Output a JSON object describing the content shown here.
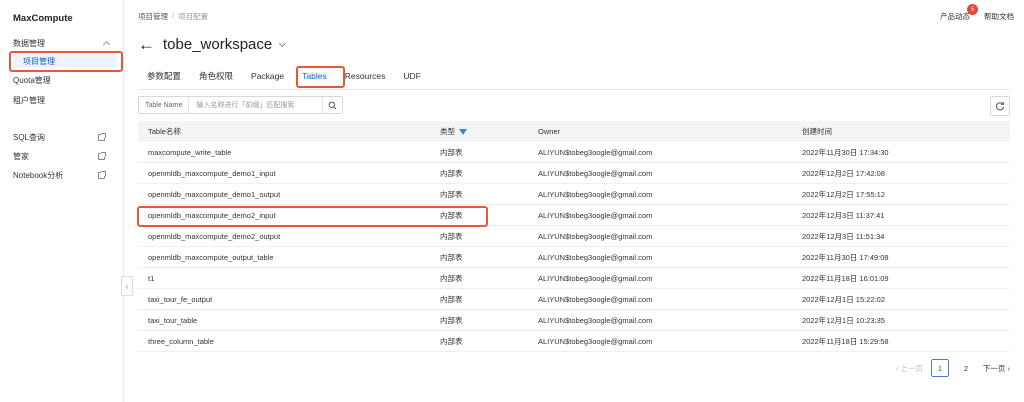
{
  "sidebar": {
    "brand": "MaxCompute",
    "group_label": "数据管理",
    "items": [
      {
        "label": "项目管理"
      },
      {
        "label": "Quota管理"
      },
      {
        "label": "租户管理"
      }
    ],
    "links": [
      {
        "label": "SQL查询"
      },
      {
        "label": "管家"
      },
      {
        "label": "Notebook分析"
      }
    ]
  },
  "header": {
    "breadcrumb": [
      "项目管理",
      "项目配置"
    ],
    "product_news": "产品动态",
    "news_badge": "5",
    "help_docs": "帮助文档"
  },
  "project": {
    "title": "tobe_workspace",
    "back_glyph": "←"
  },
  "tabs": [
    {
      "label": "参数配置"
    },
    {
      "label": "角色权限"
    },
    {
      "label": "Package"
    },
    {
      "label": "Tables"
    },
    {
      "label": "Resources"
    },
    {
      "label": "UDF"
    }
  ],
  "search": {
    "label": "Table Name",
    "placeholder": "输入名称进行「前缀」匹配搜索"
  },
  "table": {
    "columns": [
      "Table名称",
      "类型",
      "Owner",
      "创建时间"
    ],
    "rows": [
      [
        "maxcompute_write_table",
        "内部表",
        "ALIYUN$tobeg3oogle@gmail.com",
        "2022年11月30日 17:34:30"
      ],
      [
        "openmldb_maxcompute_demo1_input",
        "内部表",
        "ALIYUN$tobeg3oogle@gmail.com",
        "2022年12月2日 17:42:08"
      ],
      [
        "openmldb_maxcompute_demo1_output",
        "内部表",
        "ALIYUN$tobeg3oogle@gmail.com",
        "2022年12月2日 17:55:12"
      ],
      [
        "openmldb_maxcompute_demo2_input",
        "内部表",
        "ALIYUN$tobeg3oogle@gmail.com",
        "2022年12月3日 11:37:41"
      ],
      [
        "openmldb_maxcompute_demo2_output",
        "内部表",
        "ALIYUN$tobeg3oogle@gmail.com",
        "2022年12月3日 11:51:34"
      ],
      [
        "openmldb_maxcompute_output_table",
        "内部表",
        "ALIYUN$tobeg3oogle@gmail.com",
        "2022年11月30日 17:49:08"
      ],
      [
        "t1",
        "内部表",
        "ALIYUN$tobeg3oogle@gmail.com",
        "2022年11月18日 16:01:09"
      ],
      [
        "taxi_tour_fe_output",
        "内部表",
        "ALIYUN$tobeg3oogle@gmail.com",
        "2022年12月1日 15:22:02"
      ],
      [
        "taxi_tour_table",
        "内部表",
        "ALIYUN$tobeg3oogle@gmail.com",
        "2022年12月1日 10:23:35"
      ],
      [
        "three_column_table",
        "内部表",
        "ALIYUN$tobeg3oogle@gmail.com",
        "2022年11月18日 15:29:58"
      ]
    ]
  },
  "pagination": {
    "prev": "上一页",
    "pages": [
      "1",
      "2"
    ],
    "next": "下一页"
  },
  "colors": {
    "accent": "#0064c8",
    "highlight": "#e8573a"
  }
}
